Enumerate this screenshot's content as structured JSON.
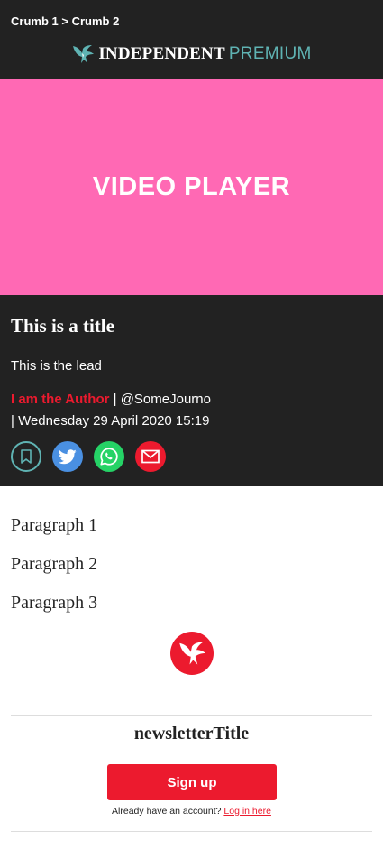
{
  "breadcrumb": {
    "items": [
      "Crumb 1",
      "Crumb 2"
    ],
    "separator": ">"
  },
  "logo": {
    "brand": "INDEPENDENT",
    "tier": "PREMIUM",
    "icon": "eagle-icon"
  },
  "video": {
    "label": "VIDEO PLAYER"
  },
  "article": {
    "title": "This is a title",
    "lead": "This is the lead",
    "author": "I am the Author",
    "byline_sep": "|",
    "handle": "@SomeJourno",
    "date_sep": "|",
    "date": "Wednesday 29 April 2020 15:19",
    "share": {
      "bookmark": "bookmark-icon",
      "twitter": "twitter-icon",
      "whatsapp": "whatsapp-icon",
      "email": "email-icon"
    },
    "paragraphs": [
      "Paragraph 1",
      "Paragraph 2",
      "Paragraph 3"
    ]
  },
  "newsletter": {
    "title": "newsletterTitle",
    "signup_label": "Sign up",
    "login_prompt": "Already have an account?",
    "login_link": "Log in here"
  },
  "colors": {
    "dark": "#222222",
    "accent_red": "#ec1a2e",
    "premium_teal": "#5fb3b3",
    "video_pink": "#ff69b4",
    "twitter_blue": "#4a90e2",
    "whatsapp_green": "#25d366"
  }
}
